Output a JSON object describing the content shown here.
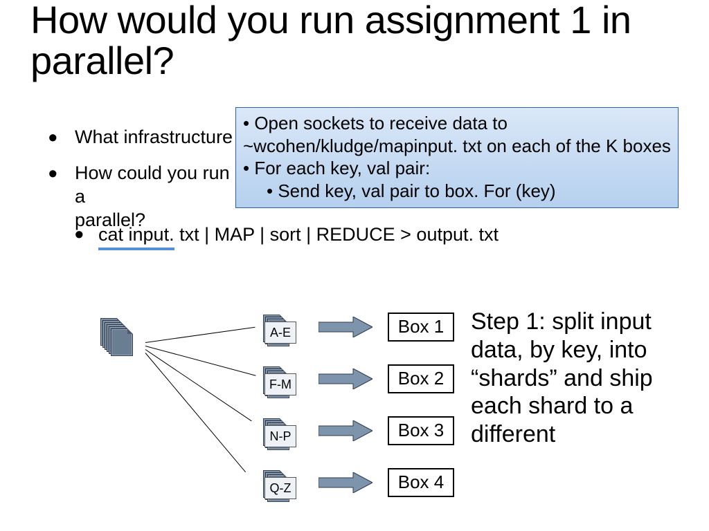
{
  "title": "How would you run assignment 1 in parallel?",
  "bullets": {
    "b1": "What infrastructure w",
    "b2": "How could you run a                                  parallel?",
    "b3": "cat input. txt | MAP | sort | REDUCE > output. txt"
  },
  "note": {
    "l1": " • Open sockets to receive data to ~wcohen/kludge/mapinput. txt on each of the K boxes",
    "l2": " • For each key, val pair:",
    "l3": " • Send key, val pair to box. For (key)"
  },
  "shards": {
    "s1": "A-E",
    "s2": "F-M",
    "s3": "N-P",
    "s4": "Q-Z"
  },
  "boxes": {
    "b1": "Box 1",
    "b2": "Box 2",
    "b3": "Box 3",
    "b4": "Box 4"
  },
  "step": "Step 1: split input data, by key, into “shards” and ship each shard to a different"
}
